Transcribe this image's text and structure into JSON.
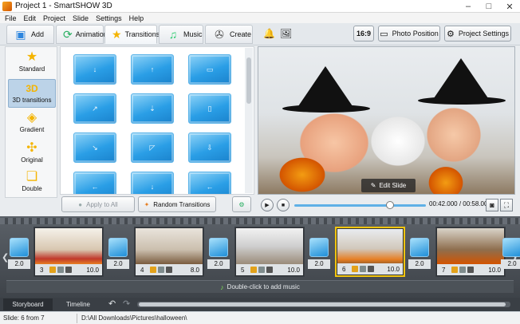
{
  "window": {
    "title": "Project 1 - SmartSHOW 3D",
    "min": "–",
    "max": "□",
    "close": "✕"
  },
  "menu": [
    "File",
    "Edit",
    "Project",
    "Slide",
    "Settings",
    "Help"
  ],
  "tabs": [
    {
      "label": "Add",
      "icon": "add-image-icon"
    },
    {
      "label": "Animation",
      "icon": "animation-icon"
    },
    {
      "label": "Transitions",
      "icon": "star-icon"
    },
    {
      "label": "Music",
      "icon": "music-icon"
    },
    {
      "label": "Create",
      "icon": "film-reel-icon"
    }
  ],
  "toolbar": {
    "aspect": "16:9",
    "photo_position": "Photo Position",
    "project_settings": "Project Settings"
  },
  "categories": [
    {
      "label": "Standard",
      "icon": "star-icon"
    },
    {
      "label": "3D transitions",
      "icon": "3d-icon",
      "glyph": "3D",
      "active": true
    },
    {
      "label": "Gradient",
      "icon": "gradient-icon"
    },
    {
      "label": "Original",
      "icon": "puzzle-icon"
    },
    {
      "label": "Double",
      "icon": "double-icon"
    }
  ],
  "transitions_grid": {
    "buttons": {
      "apply_all": "Apply to All",
      "random": "Random Transitions"
    }
  },
  "preview": {
    "edit_slide": "Edit Slide",
    "timecode": "00:42.000 / 00:58.000"
  },
  "storyboard": {
    "slides": [
      {
        "num": "",
        "duration": "2.0",
        "partial": true
      },
      {
        "num": "3",
        "duration": "10.0"
      },
      {
        "num": "4",
        "duration": "8.0"
      },
      {
        "num": "5",
        "duration": "10.0"
      },
      {
        "num": "6",
        "duration": "10.0",
        "active": true
      },
      {
        "num": "7",
        "duration": "10.0"
      }
    ],
    "transitions": [
      "2.0",
      "2.0",
      "2.0",
      "2.0",
      "2.0"
    ],
    "music_hint": "Double-click to add music"
  },
  "bottom_tabs": {
    "storyboard": "Storyboard",
    "timeline": "Timeline"
  },
  "status": {
    "slide": "Slide: 6 from 7",
    "path": "D:\\All Downloads\\Pictures\\halloween\\"
  },
  "colors": {
    "accent": "#2a9ee6",
    "active_slide_border": "#f1c40f"
  }
}
